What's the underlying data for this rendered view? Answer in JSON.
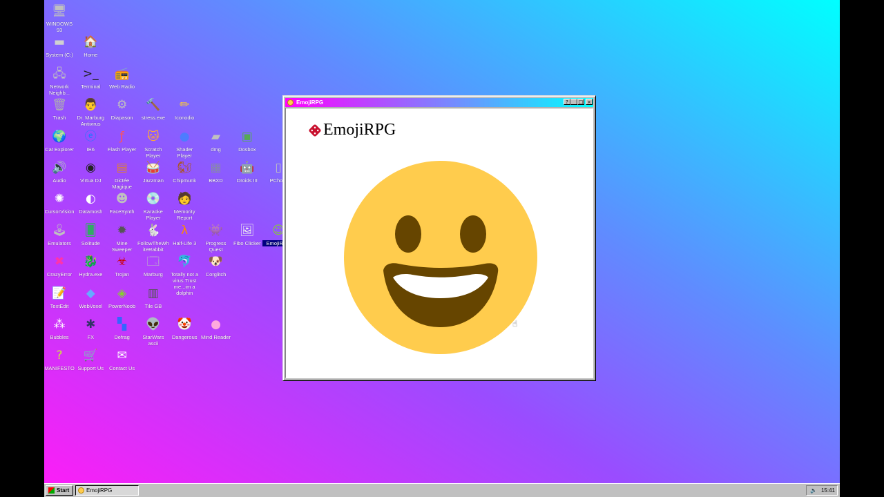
{
  "desktop": {
    "icons": [
      {
        "label": "WINDOWS 93",
        "glyph": "🖥",
        "color": "#c0c0c0"
      },
      {
        "label": "System (C:)",
        "glyph": "▬",
        "color": "#d0d0d0"
      },
      {
        "label": "Home",
        "glyph": "🏠",
        "color": "#e6c65a"
      },
      {
        "label": "Network Neighb...",
        "glyph": "🖧",
        "color": "#c0c0c0"
      },
      {
        "label": "Terminal",
        "glyph": ">_",
        "color": "#202020"
      },
      {
        "label": "Web Radio",
        "glyph": "📻",
        "color": "#c0c0c0"
      },
      {
        "label": "Trash",
        "glyph": "🗑",
        "color": "#b0b0b0"
      },
      {
        "label": "Dr. Marburg Antivirus",
        "glyph": "👨",
        "color": "#e0a080"
      },
      {
        "label": "Diapason",
        "glyph": "⚙",
        "color": "#c0c0c0"
      },
      {
        "label": "stress.exe",
        "glyph": "🔨",
        "color": "#a0a0a0"
      },
      {
        "label": "Iconodio",
        "glyph": "✏",
        "color": "#ffcc33"
      },
      {
        "label": "Cat Explorer",
        "glyph": "🌍",
        "color": "#3b8cff"
      },
      {
        "label": "IE6",
        "glyph": "ⓔ",
        "color": "#1e78ff"
      },
      {
        "label": "Flash Player",
        "glyph": "ƒ",
        "color": "#ff5555"
      },
      {
        "label": "Scratch Player",
        "glyph": "🐱",
        "color": "#ffaa33"
      },
      {
        "label": "Shader Player",
        "glyph": "●",
        "color": "#4d7cff"
      },
      {
        "label": "dmg",
        "glyph": "▰",
        "color": "#c0c0c0"
      },
      {
        "label": "Dosbox",
        "glyph": "▣",
        "color": "#55aa55"
      },
      {
        "label": "Audio",
        "glyph": "🔊",
        "color": "#ffffff"
      },
      {
        "label": "Virtua DJ",
        "glyph": "◉",
        "color": "#222222"
      },
      {
        "label": "Dictée Magique",
        "glyph": "▤",
        "color": "#e08030"
      },
      {
        "label": "Jazzman",
        "glyph": "🥁",
        "color": "#c0c0c0"
      },
      {
        "label": "Chipmunk",
        "glyph": "🐿",
        "color": "#aa5522"
      },
      {
        "label": "BBXD",
        "glyph": "▦",
        "color": "#8888aa"
      },
      {
        "label": "Droids III",
        "glyph": "🤖",
        "color": "#66aa66"
      },
      {
        "label": "PCho...",
        "glyph": "▯",
        "color": "#c0c0c0"
      },
      {
        "label": "CursorVision",
        "glyph": "✺",
        "color": "#ffffff"
      },
      {
        "label": "Datamosh",
        "glyph": "◐",
        "color": "#ffffff"
      },
      {
        "label": "FaceSynth",
        "glyph": "☻",
        "color": "#c0c0c0"
      },
      {
        "label": "Karaoke Player",
        "glyph": "💿",
        "color": "#d0d0d0"
      },
      {
        "label": "Memority Report",
        "glyph": "🧑",
        "color": "#e0a080"
      },
      {
        "label": "Emulators",
        "glyph": "🕹",
        "color": "#c0c0c0"
      },
      {
        "label": "Solitude",
        "glyph": "🂠",
        "color": "#33aa66"
      },
      {
        "label": "Mine Sweeper",
        "glyph": "✹",
        "color": "#555555"
      },
      {
        "label": "FollowTheWhiteRabbit",
        "glyph": "🐇",
        "color": "#ffffff"
      },
      {
        "label": "Half-Life 3",
        "glyph": "λ",
        "color": "#ff8800"
      },
      {
        "label": "Progress Quest",
        "glyph": "👾",
        "color": "#cc3333"
      },
      {
        "label": "Fibo Clicker",
        "glyph": "🖼",
        "color": "#eeeeee"
      },
      {
        "label": "EmojiRPG",
        "glyph": "☺",
        "color": "#88cc33"
      },
      {
        "label": "CrazyError",
        "glyph": "✖",
        "color": "#ff33aa"
      },
      {
        "label": "Hydra.exe",
        "glyph": "🐉",
        "color": "#338833"
      },
      {
        "label": "Trojan",
        "glyph": "☣",
        "color": "#cc0000"
      },
      {
        "label": "Marburg",
        "glyph": "🗔",
        "color": "#c0c0c0"
      },
      {
        "label": "Totally not a virus.Trust me...im a dolphin",
        "glyph": "🐬",
        "color": "#3399ff"
      },
      {
        "label": "Corglitch",
        "glyph": "🐶",
        "color": "#e0a050"
      },
      {
        "label": "TextEdit",
        "glyph": "📝",
        "color": "#ffffff"
      },
      {
        "label": "WebVoxel",
        "glyph": "◆",
        "color": "#66aaff"
      },
      {
        "label": "PowerNoob",
        "glyph": "◈",
        "color": "#88cc33"
      },
      {
        "label": "Tile GB",
        "glyph": "▥",
        "color": "#555555"
      },
      {
        "label": "Bubbles",
        "glyph": "⁂",
        "color": "#ffffff"
      },
      {
        "label": "FX",
        "glyph": "✱",
        "color": "#333366"
      },
      {
        "label": "Defrag",
        "glyph": "▚",
        "color": "#3366ff"
      },
      {
        "label": "StarWars ascii",
        "glyph": "👽",
        "color": "#66aa33"
      },
      {
        "label": "Dangerous",
        "glyph": "🤡",
        "color": "#cc3333"
      },
      {
        "label": "Mind Reader",
        "glyph": "●",
        "color": "#ffaadd"
      },
      {
        "label": "MANIFESTO",
        "glyph": "?",
        "color": "#ccee33"
      },
      {
        "label": "Support Us",
        "glyph": "🛒",
        "color": "#c0c0c0"
      },
      {
        "label": "Contact Us",
        "glyph": "✉",
        "color": "#ffffff"
      }
    ]
  },
  "window": {
    "title": "EmojiRPG",
    "buttons": {
      "help": "?",
      "minimize": "_",
      "maximize": "□",
      "close": "×"
    },
    "app_heading": "EmojiRPG",
    "emoji_colors": {
      "face": "#ffcc4d",
      "features": "#664500",
      "teeth": "#ffffff"
    }
  },
  "taskbar": {
    "start_label": "Start",
    "task_label": "EmojiRPG",
    "clock": "15:41"
  },
  "colors": {
    "window_gray": "#c0c0c0",
    "title_start": "#ff00ff",
    "title_end": "#00ffff"
  }
}
